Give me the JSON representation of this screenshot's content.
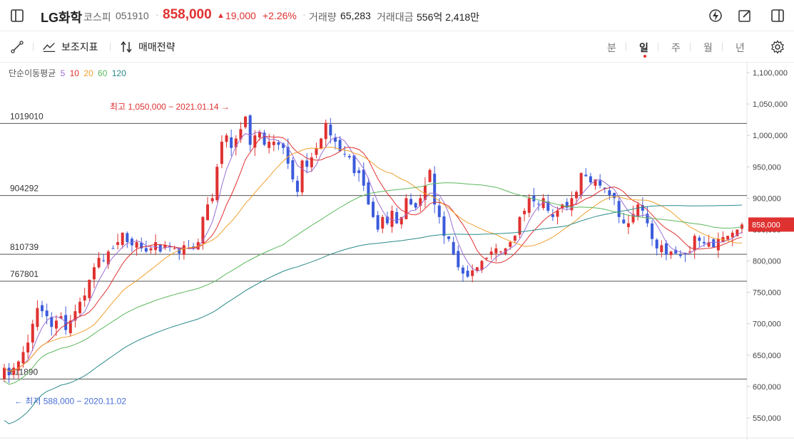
{
  "header": {
    "name": "LG화학",
    "market": "코스피",
    "code": "051910",
    "sep": "·",
    "price": "858,000",
    "change_arrow": "▲",
    "change": "19,000",
    "change_pct": "+2.26%",
    "volume_label": "거래량",
    "volume": "65,283",
    "amount_label": "거래대금",
    "amount": "556억 2,418만",
    "colors": {
      "up": "#e03131",
      "down": "#3b5bdb"
    }
  },
  "toolbar": {
    "indicator_label": "보조지표",
    "strategy_label": "매매전략",
    "periods": [
      "분",
      "일",
      "주",
      "월",
      "년"
    ],
    "active_period": "일"
  },
  "legend": {
    "title": "단순이동평균",
    "ma": [
      {
        "label": "5",
        "color": "#9b6fd6"
      },
      {
        "label": "10",
        "color": "#e03131"
      },
      {
        "label": "20",
        "color": "#f0a030"
      },
      {
        "label": "60",
        "color": "#5cb85c"
      },
      {
        "label": "120",
        "color": "#2a8a8a"
      }
    ]
  },
  "chart_data": {
    "type": "candlestick",
    "ylim": [
      540000,
      1110000
    ],
    "y_ticks": [
      "1,100,000",
      "1,050,000",
      "1,000,000",
      "950,000",
      "900,000",
      "850,000",
      "800,000",
      "750,000",
      "700,000",
      "650,000",
      "600,000",
      "550,000"
    ],
    "y_tick_values": [
      1100000,
      1050000,
      1000000,
      950000,
      900000,
      850000,
      800000,
      750000,
      700000,
      650000,
      600000,
      550000
    ],
    "current_price_label": "858,000",
    "current_price": 858000,
    "horizontal_levels": [
      {
        "label": "1019010",
        "value": 1019010
      },
      {
        "label": "904292",
        "value": 904292
      },
      {
        "label": "810739",
        "value": 810739
      },
      {
        "label": "767801",
        "value": 767801
      },
      {
        "label": "611890",
        "value": 611890
      }
    ],
    "high_annotation": "최고 1,050,000 − 2021.01.14 →",
    "low_annotation": "← 최저 588,000 − 2020.11.02",
    "high_value": 1050000,
    "low_value": 588000,
    "closes": [
      630000,
      618000,
      630000,
      640000,
      655000,
      670000,
      700000,
      725000,
      720000,
      712000,
      695000,
      705000,
      712000,
      690000,
      705000,
      720000,
      735000,
      745000,
      770000,
      790000,
      805000,
      800000,
      815000,
      820000,
      830000,
      845000,
      830000,
      825000,
      830000,
      820000,
      815000,
      820000,
      830000,
      815000,
      825000,
      822000,
      820000,
      812000,
      825000,
      820000,
      820000,
      830000,
      870000,
      890000,
      900000,
      950000,
      990000,
      1000000,
      980000,
      995000,
      1010000,
      1030000,
      985000,
      1000000,
      1005000,
      985000,
      990000,
      990000,
      985000,
      980000,
      955000,
      930000,
      910000,
      960000,
      950000,
      965000,
      980000,
      995000,
      1020000,
      1000000,
      990000,
      975000,
      970000,
      965000,
      940000,
      940000,
      920000,
      890000,
      870000,
      850000,
      870000,
      860000,
      880000,
      860000,
      870000,
      900000,
      890000,
      885000,
      900000,
      920000,
      945000,
      890000,
      870000,
      840000,
      835000,
      810000,
      790000,
      780000,
      775000,
      785000,
      790000,
      800000,
      805000,
      815000,
      820000,
      815000,
      820000,
      830000,
      840000,
      870000,
      880000,
      900000,
      895000,
      890000,
      900000,
      880000,
      870000,
      880000,
      890000,
      885000,
      900000,
      910000,
      940000,
      935000,
      925000,
      930000,
      920000,
      915000,
      905000,
      900000,
      870000,
      860000,
      860000,
      875000,
      890000,
      880000,
      860000,
      835000,
      820000,
      825000,
      810000,
      815000,
      812000,
      808000,
      812000,
      815000,
      840000,
      832000,
      828000,
      830000,
      822000,
      835000,
      838000,
      840000,
      845000,
      850000,
      858000
    ],
    "ma_periods": [
      5,
      10,
      20,
      60,
      120
    ]
  }
}
